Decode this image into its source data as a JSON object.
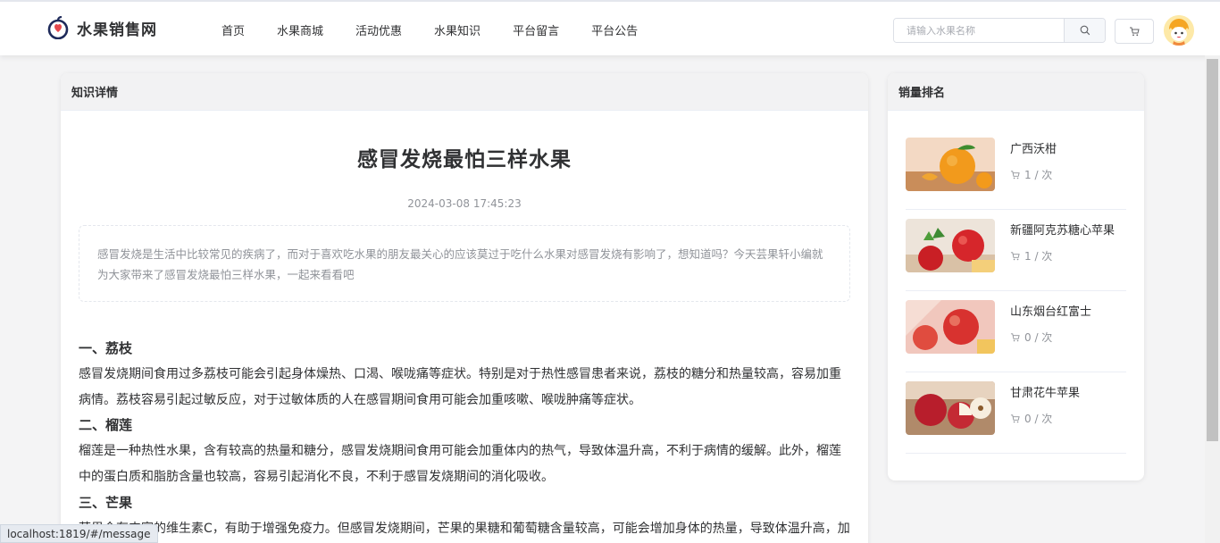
{
  "header": {
    "site_name": "水果销售网",
    "nav": [
      "首页",
      "水果商城",
      "活动优惠",
      "水果知识",
      "平台留言",
      "平台公告"
    ],
    "search_placeholder": "请输入水果名称"
  },
  "detail": {
    "section_title": "知识详情",
    "title": "感冒发烧最怕三样水果",
    "date": "2024-03-08 17:45:23",
    "summary": "感冒发烧是生活中比较常见的疾病了，而对于喜欢吃水果的朋友最关心的应该莫过于吃什么水果对感冒发烧有影响了，想知道吗？今天芸果轩小编就为大家带来了感冒发烧最怕三样水果，一起来看看吧",
    "sections": [
      {
        "heading": "一、荔枝",
        "text": "感冒发烧期间食用过多荔枝可能会引起身体燥热、口渴、喉咙痛等症状。特别是对于热性感冒患者来说，荔枝的糖分和热量较高，容易加重病情。荔枝容易引起过敏反应，对于过敏体质的人在感冒期间食用可能会加重咳嗽、喉咙肿痛等症状。"
      },
      {
        "heading": "二、榴莲",
        "text": "榴莲是一种热性水果，含有较高的热量和糖分，感冒发烧期间食用可能会加重体内的热气，导致体温升高，不利于病情的缓解。此外，榴莲中的蛋白质和脂肪含量也较高，容易引起消化不良，不利于感冒发烧期间的消化吸收。"
      },
      {
        "heading": "三、芒果",
        "text": "芒果含有丰富的维生素C，有助于增强免疫力。但感冒发烧期间，芒果的果糖和葡萄糖含量较高，可能会增加身体的热量，导致体温升高，加重病情。芒果容易引起过敏反应，对于过敏体质的人在感冒期间食用可能会加重咳嗽、喉咙肿痛等症状。"
      }
    ]
  },
  "ranking": {
    "section_title": "销量排名",
    "items": [
      {
        "name": "广西沃柑",
        "sales": "1 / 次",
        "image": "orange"
      },
      {
        "name": "新疆阿克苏糖心苹果",
        "sales": "1 / 次",
        "image": "apple-red"
      },
      {
        "name": "山东烟台红富士",
        "sales": "0 / 次",
        "image": "apple-fuji"
      },
      {
        "name": "甘肃花牛苹果",
        "sales": "0 / 次",
        "image": "apple-cut"
      }
    ]
  },
  "status_url": "localhost:1819/#/message"
}
